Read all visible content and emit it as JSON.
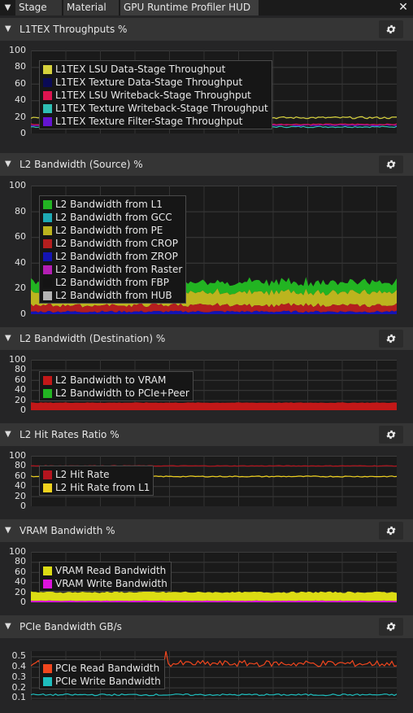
{
  "tabs": [
    {
      "label": "Stage"
    },
    {
      "label": "Material"
    },
    {
      "label": "GPU Runtime Profiler HUD"
    }
  ],
  "panels": [
    {
      "title": "L1TEX Throughputs %",
      "yticks": [
        "100",
        "80",
        "60",
        "40",
        "20",
        "0"
      ],
      "legend": [
        {
          "label": "L1TEX LSU Data-Stage Throughput",
          "color": "#d6d13c"
        },
        {
          "label": "L1TEX Texture Data-Stage Throughput",
          "color": "#0a0a55"
        },
        {
          "label": "L1TEX LSU Writeback-Stage Throughput",
          "color": "#dc1450"
        },
        {
          "label": "L1TEX Texture Writeback-Stage Throughput",
          "color": "#2ebeb4"
        },
        {
          "label": "L1TEX Texture Filter-Stage Throughput",
          "color": "#6414d2"
        }
      ]
    },
    {
      "title": "L2 Bandwidth (Source) %",
      "yticks": [
        "100",
        "80",
        "60",
        "40",
        "20",
        "0"
      ],
      "legend": [
        {
          "label": "L2 Bandwidth from L1",
          "color": "#22b422"
        },
        {
          "label": "L2 Bandwidth from GCC",
          "color": "#1eaab4"
        },
        {
          "label": "L2 Bandwidth from PE",
          "color": "#bcb41e"
        },
        {
          "label": "L2 Bandwidth from CROP",
          "color": "#b41e1e"
        },
        {
          "label": "L2 Bandwidth from ZROP",
          "color": "#1414b4"
        },
        {
          "label": "L2 Bandwidth from Raster",
          "color": "#b41eb4"
        },
        {
          "label": "L2 Bandwidth from FBP",
          "color": "#141414"
        },
        {
          "label": "L2 Bandwidth from HUB",
          "color": "#b4b4b4"
        }
      ]
    },
    {
      "title": "L2 Bandwidth (Destination) %",
      "yticks": [
        "100",
        "80",
        "60",
        "40",
        "20",
        "0"
      ],
      "legend": [
        {
          "label": "L2 Bandwidth to VRAM",
          "color": "#c21818"
        },
        {
          "label": "L2 Bandwidth to PCIe+Peer",
          "color": "#22b422"
        }
      ]
    },
    {
      "title": "L2 Hit Rates Ratio %",
      "yticks": [
        "100",
        "80",
        "60",
        "40",
        "20",
        "0"
      ],
      "legend": [
        {
          "label": "L2 Hit Rate",
          "color": "#b4141e"
        },
        {
          "label": "L2 Hit Rate from L1",
          "color": "#f0d21e"
        }
      ]
    },
    {
      "title": "VRAM Bandwidth %",
      "yticks": [
        "100",
        "80",
        "60",
        "40",
        "20",
        "0"
      ],
      "legend": [
        {
          "label": "VRAM Read Bandwidth",
          "color": "#dcdc14"
        },
        {
          "label": "VRAM Write Bandwidth",
          "color": "#dc14dc"
        }
      ]
    },
    {
      "title": "PCIe Bandwidth GB/s",
      "yticks": [
        "0.5",
        "0.4",
        "0.3",
        "0.2",
        "0.1"
      ],
      "legend": [
        {
          "label": "PCIe Read Bandwidth",
          "color": "#f0461e"
        },
        {
          "label": "PCIe Write Bandwidth",
          "color": "#1ebebe"
        }
      ]
    }
  ],
  "chart_data": [
    {
      "type": "area",
      "title": "L1TEX Throughputs %",
      "ylim": [
        0,
        100
      ],
      "grid": true,
      "legend_position": "top-left",
      "series": [
        {
          "name": "L1TEX LSU Data-Stage Throughput",
          "typical": 19
        },
        {
          "name": "L1TEX Texture Data-Stage Throughput",
          "typical": 0
        },
        {
          "name": "L1TEX LSU Writeback-Stage Throughput",
          "typical": 11
        },
        {
          "name": "L1TEX Texture Writeback-Stage Throughput",
          "typical": 8
        },
        {
          "name": "L1TEX Texture Filter-Stage Throughput",
          "typical": 10
        }
      ]
    },
    {
      "type": "area",
      "title": "L2 Bandwidth (Source) %",
      "ylim": [
        0,
        100
      ],
      "grid": true,
      "stacked": true,
      "legend_position": "top-left",
      "series": [
        {
          "name": "L2 Bandwidth from L1",
          "typical": 8
        },
        {
          "name": "L2 Bandwidth from GCC",
          "typical": 0
        },
        {
          "name": "L2 Bandwidth from PE",
          "typical": 10
        },
        {
          "name": "L2 Bandwidth from CROP",
          "typical": 5
        },
        {
          "name": "L2 Bandwidth from ZROP",
          "typical": 2
        },
        {
          "name": "L2 Bandwidth from Raster",
          "typical": 0
        },
        {
          "name": "L2 Bandwidth from FBP",
          "typical": 0
        },
        {
          "name": "L2 Bandwidth from HUB",
          "typical": 0
        }
      ]
    },
    {
      "type": "area",
      "title": "L2 Bandwidth (Destination) %",
      "ylim": [
        0,
        100
      ],
      "grid": true,
      "legend_position": "top-left",
      "series": [
        {
          "name": "L2 Bandwidth to VRAM",
          "typical": 15
        },
        {
          "name": "L2 Bandwidth to PCIe+Peer",
          "typical": 0
        }
      ]
    },
    {
      "type": "line",
      "title": "L2 Hit Rates Ratio %",
      "ylim": [
        0,
        100
      ],
      "grid": true,
      "legend_position": "top-left",
      "series": [
        {
          "name": "L2 Hit Rate",
          "typical": 80
        },
        {
          "name": "L2 Hit Rate from L1",
          "typical": 59
        }
      ]
    },
    {
      "type": "area",
      "title": "VRAM Bandwidth %",
      "ylim": [
        0,
        100
      ],
      "grid": true,
      "legend_position": "top-left",
      "series": [
        {
          "name": "VRAM Read Bandwidth",
          "typical": 20
        },
        {
          "name": "VRAM Write Bandwidth",
          "typical": 3
        }
      ]
    },
    {
      "type": "line",
      "title": "PCIe Bandwidth GB/s",
      "ylim": [
        0.08,
        0.55
      ],
      "grid": true,
      "legend_position": "top-left",
      "series": [
        {
          "name": "PCIe Read Bandwidth",
          "typical": 0.43
        },
        {
          "name": "PCIe Write Bandwidth",
          "typical": 0.13
        }
      ]
    }
  ]
}
